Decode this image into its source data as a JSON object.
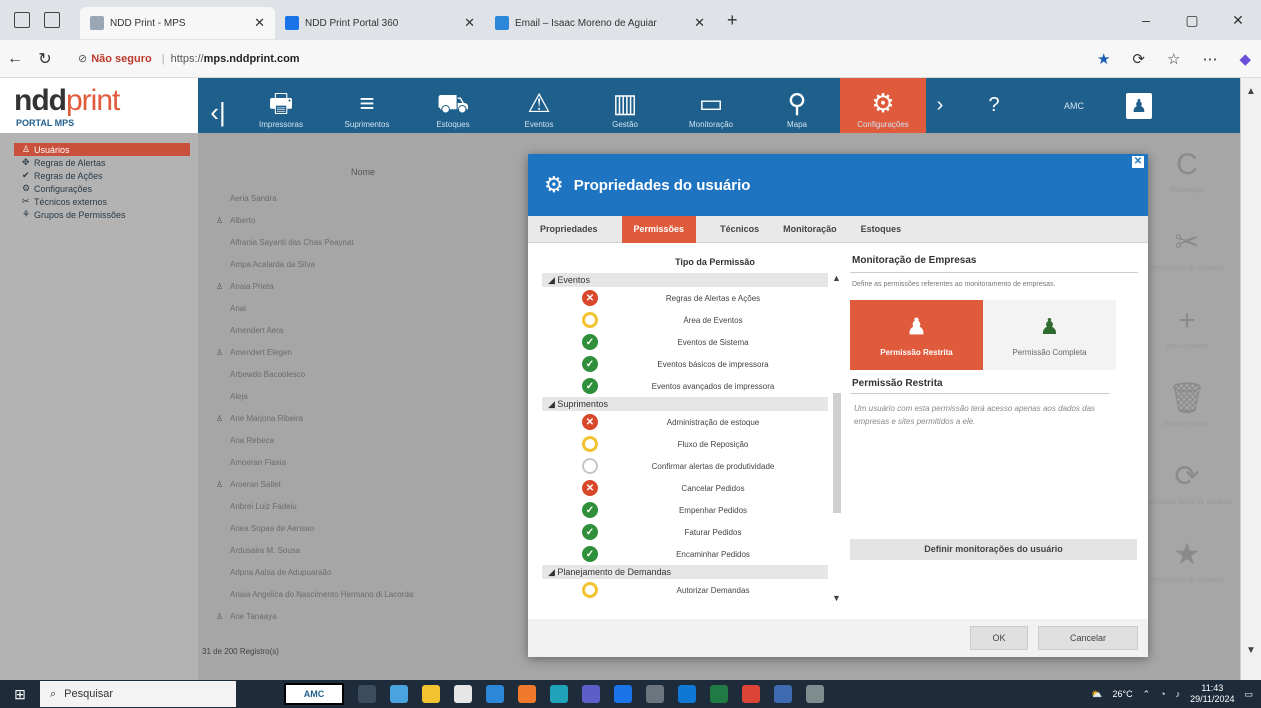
{
  "browser": {
    "tabs": [
      {
        "title": "NDD Print - MPS",
        "active": true,
        "color": "#9aa7b5"
      },
      {
        "title": "NDD Print Portal 360",
        "active": false,
        "color": "#1a73e8"
      },
      {
        "title": "Email – Isaac Moreno de Aguiar",
        "active": false,
        "color": "#2b88d8"
      }
    ],
    "address": {
      "warning": "Não seguro",
      "url_prefix": "https://",
      "url_host": "mps.nddprint.com"
    }
  },
  "app": {
    "logo_ndd": "ndd",
    "logo_print": "print",
    "logo_sub": "PORTAL MPS",
    "topnav": [
      {
        "label": "",
        "glyph": "‹|",
        "active": false
      },
      {
        "label": "Impressoras",
        "glyph": "🖶",
        "active": false
      },
      {
        "label": "Suprimentos",
        "glyph": "≡",
        "active": false
      },
      {
        "label": "Estoques",
        "glyph": "⛟",
        "active": false
      },
      {
        "label": "Eventos",
        "glyph": "⚠",
        "active": false
      },
      {
        "label": "Gestão",
        "glyph": "▥",
        "active": false
      },
      {
        "label": "Monitoração",
        "glyph": "▭",
        "active": false
      },
      {
        "label": "Mapa",
        "glyph": "⚲",
        "active": false
      },
      {
        "label": "Configurações",
        "glyph": "⚙",
        "active": true
      }
    ],
    "help": "?",
    "user_label": "AMC"
  },
  "sidebar": {
    "items": [
      {
        "label": "Usuários",
        "icon": "user-icon",
        "glyph": "♙",
        "active": true
      },
      {
        "label": "Regras de Alertas",
        "icon": "rules-icon",
        "glyph": "✥",
        "active": false
      },
      {
        "label": "Regras de Ações",
        "icon": "check-icon",
        "glyph": "✔",
        "active": false
      },
      {
        "label": "Configurações",
        "icon": "gear-icon",
        "glyph": "⚙",
        "active": false
      },
      {
        "label": "Técnicos externos",
        "icon": "tech-icon",
        "glyph": "✂",
        "active": false
      },
      {
        "label": "Grupos de Permissões",
        "icon": "group-icon",
        "glyph": "⚘",
        "active": false
      }
    ]
  },
  "list": {
    "header": "Nome",
    "rows": [
      {
        "text": "Aeria Sandra",
        "user": false
      },
      {
        "text": "Alberto",
        "user": true
      },
      {
        "text": "Alfrania Sayanti das Chas Peaynat",
        "user": false
      },
      {
        "text": "Ampa Acalarda da Silva",
        "user": false
      },
      {
        "text": "Anaia Prieta",
        "user": true
      },
      {
        "text": "Anai",
        "user": false
      },
      {
        "text": "Amendert Aera",
        "user": false
      },
      {
        "text": "Amendert Elegen",
        "user": true
      },
      {
        "text": "Arbewdo Bacoolesco",
        "user": false
      },
      {
        "text": "Aleja",
        "user": false
      },
      {
        "text": "Ane Marjona Ribeira",
        "user": true
      },
      {
        "text": "Ana Rebeca",
        "user": false
      },
      {
        "text": "Amoeran Flaxia",
        "user": false
      },
      {
        "text": "Aroeran Sallet",
        "user": true
      },
      {
        "text": "Anbrei Luiz Fadeiu",
        "user": false
      },
      {
        "text": "Anea Sopaa de Aensao",
        "user": false
      },
      {
        "text": "Ardusaira M. Sousa",
        "user": false
      },
      {
        "text": "Arlpna Aalsa de Adupuaraão",
        "user": false
      },
      {
        "text": "Anaia Angelica do Nascimento Hermano di Lacorda",
        "user": false
      },
      {
        "text": "Ane Tanaaya",
        "user": true
      }
    ],
    "records": "31 de 200 Registro(s)"
  },
  "right_actions": [
    {
      "label": "Recarregar",
      "glyph": "C"
    },
    {
      "label": "Permissões de usuários",
      "glyph": "✂"
    },
    {
      "label": "Novo usuário",
      "glyph": "+"
    },
    {
      "label": "Excluir usuário",
      "glyph": "🗑"
    },
    {
      "label": "Sincronizar perfis de usuários",
      "glyph": "⟳"
    },
    {
      "label": "Permissões de usuários",
      "glyph": "★"
    }
  ],
  "modal": {
    "title": "Propriedades do usuário",
    "tabs": [
      {
        "label": "Propriedades",
        "active": false
      },
      {
        "label": "Permissões",
        "active": true
      },
      {
        "label": "Técnicos",
        "active": false
      },
      {
        "label": "Monitoração",
        "active": false
      },
      {
        "label": "Estoques",
        "active": false
      }
    ],
    "perm_header": "Tipo da Permissão",
    "groups": [
      {
        "name": "Eventos",
        "items": [
          {
            "label": "Regras de Alertas e Ações",
            "status": "red"
          },
          {
            "label": "Área de Eventos",
            "status": "yellow"
          },
          {
            "label": "Eventos de Sistema",
            "status": "green"
          },
          {
            "label": "Eventos básicos de impressora",
            "status": "green"
          },
          {
            "label": "Eventos avançados de impressora",
            "status": "green"
          }
        ]
      },
      {
        "name": "Suprimentos",
        "items": [
          {
            "label": "Administração de estoque",
            "status": "red"
          },
          {
            "label": "Fluxo de Reposição",
            "status": "yellow"
          },
          {
            "label": "Confirmar alertas de produtividade",
            "status": "gray"
          },
          {
            "label": "Cancelar Pedidos",
            "status": "red"
          },
          {
            "label": "Empenhar Pedidos",
            "status": "green"
          },
          {
            "label": "Faturar Pedidos",
            "status": "green"
          },
          {
            "label": "Encaminhar Pedidos",
            "status": "green"
          }
        ]
      },
      {
        "name": "Planejamento de Demandas",
        "items": [
          {
            "label": "Autorizar Demandas",
            "status": "yellow"
          }
        ]
      }
    ],
    "monitor": {
      "title": "Monitoração de Empresas",
      "desc": "Define as permissões referentes ao monitoramento de empresas.",
      "btn_restricted": "Permissão Restrita",
      "btn_full": "Permissão Completa",
      "sub_title": "Permissão Restrita",
      "text": "Um usuário com esta permissão terá acesso apenas aos dados das empresas e sites permitidos a ele.",
      "define_btn": "Definir monitorações do usuário"
    },
    "ok": "OK",
    "cancel": "Cancelar"
  },
  "taskbar": {
    "search": "Pesquisar",
    "amc": "AMC",
    "weather": "26°C",
    "time": "11:43",
    "date": "29/11/2024"
  }
}
